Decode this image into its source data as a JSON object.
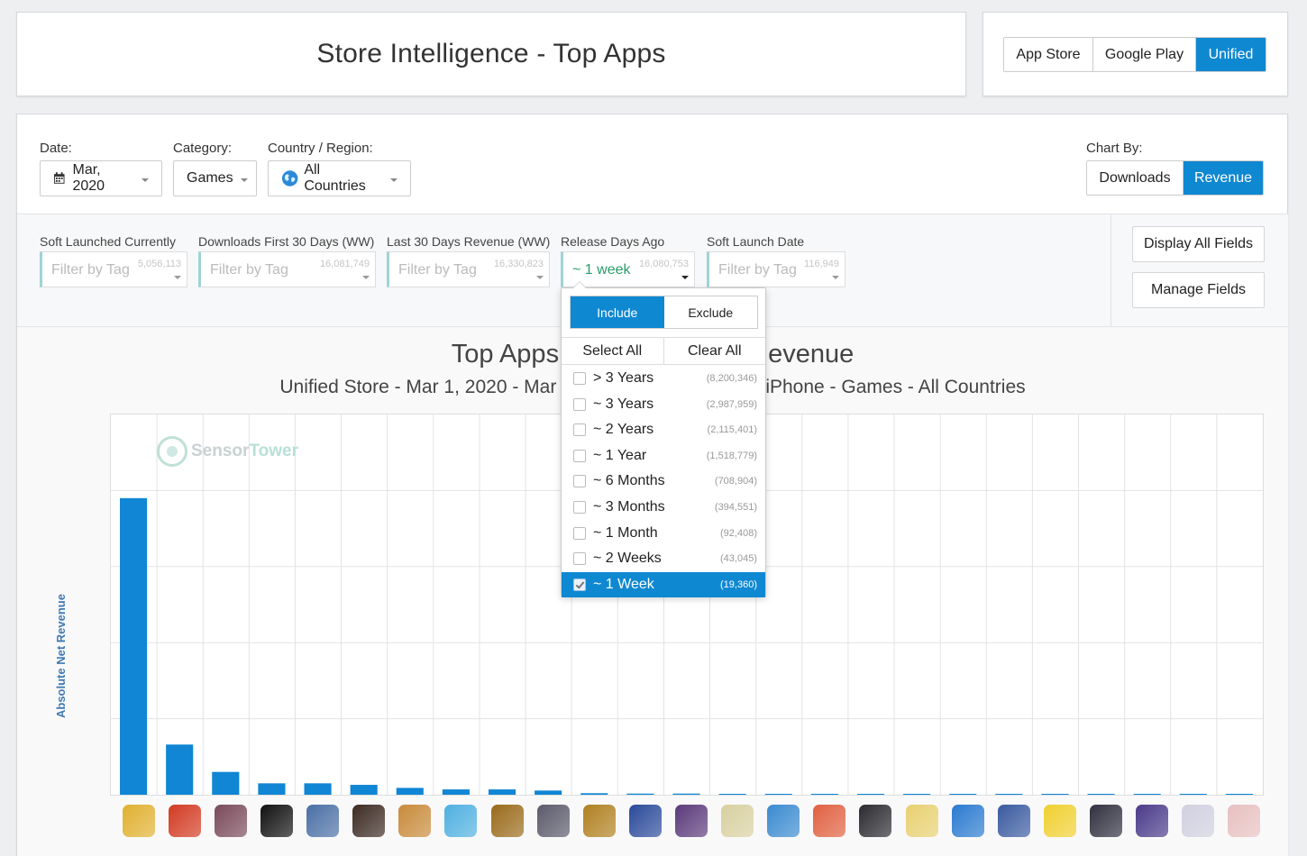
{
  "header": {
    "title": "Store Intelligence - Top Apps"
  },
  "store_toggle": [
    {
      "label": "App Store",
      "active": false
    },
    {
      "label": "Google Play",
      "active": false
    },
    {
      "label": "Unified",
      "active": true
    }
  ],
  "filters": {
    "date_label": "Date:",
    "date_value": "Mar, 2020",
    "category_label": "Category:",
    "category_value": "Games",
    "country_label": "Country / Region:",
    "country_value": "All Countries",
    "chart_by_label": "Chart By:",
    "chart_by": [
      {
        "label": "Downloads",
        "active": false
      },
      {
        "label": "Revenue",
        "active": true
      }
    ]
  },
  "tag_fields": [
    {
      "label": "Soft Launched Currently",
      "placeholder": "Filter by Tag",
      "count": "5,056,113"
    },
    {
      "label": "Downloads First 30 Days (WW)",
      "placeholder": "Filter by Tag",
      "count": "16,081,749"
    },
    {
      "label": "Last 30 Days Revenue (WW)",
      "placeholder": "Filter by Tag",
      "count": "16,330,823"
    },
    {
      "label": "Release Days Ago",
      "value": "~ 1 week",
      "count": "16,080,753"
    },
    {
      "label": "Soft Launch Date",
      "placeholder": "Filter by Tag",
      "count": "116,949"
    }
  ],
  "side_buttons": {
    "display_all": "Display All Fields",
    "manage": "Manage Fields"
  },
  "dropdown": {
    "include": "Include",
    "exclude": "Exclude",
    "select_all": "Select All",
    "clear_all": "Clear All",
    "options": [
      {
        "label": "> 3 Years",
        "count": "(8,200,346)",
        "checked": false
      },
      {
        "label": "~ 3 Years",
        "count": "(2,987,959)",
        "checked": false
      },
      {
        "label": "~ 2 Years",
        "count": "(2,115,401)",
        "checked": false
      },
      {
        "label": "~ 1 Year",
        "count": "(1,518,779)",
        "checked": false
      },
      {
        "label": "~ 6 Months",
        "count": "(708,904)",
        "checked": false
      },
      {
        "label": "~ 3 Months",
        "count": "(394,551)",
        "checked": false
      },
      {
        "label": "~ 1 Month",
        "count": "(92,408)",
        "checked": false
      },
      {
        "label": "~ 2 Weeks",
        "count": "(43,045)",
        "checked": false
      },
      {
        "label": "~ 1 Week",
        "count": "(19,360)",
        "checked": true
      }
    ]
  },
  "chart": {
    "title_left": "Top Apps",
    "title_right": "evenue",
    "subtitle_left": "Unified Store - Mar 1, 2020 - Mar",
    "subtitle_right": "iPhone - Games - All Countries",
    "watermark_a": "Sensor",
    "watermark_b": "Tower"
  },
  "chart_data": {
    "type": "bar",
    "ylabel": "Absolute Net Revenue",
    "ylim": [
      0,
      100
    ],
    "values": [
      78,
      13.2,
      6,
      3,
      3,
      2.6,
      1.8,
      1.4,
      1.4,
      1.1,
      0.4,
      0.3,
      0.3,
      0.2,
      0.2,
      0.15,
      0.12,
      0.1,
      0.1,
      0.08,
      0.07,
      0.06,
      0.05,
      0.05,
      0.04
    ]
  },
  "app_icons": [
    "#e0b030",
    "#d23a22",
    "#7a4a5a",
    "#111111",
    "#4a6fa5",
    "#3b2a22",
    "#c88a3a",
    "#4fb0e0",
    "#9a6a1a",
    "#5a5a6a",
    "#b08020",
    "#2a4a9a",
    "#5a3a7a",
    "#d8d0a0",
    "#3a8ad0",
    "#e06040",
    "#2a2a30",
    "#e8d070",
    "#2a7ad0",
    "#3a5aa0",
    "#f0d030",
    "#303040",
    "#4a3a8a",
    "#d0d0e0",
    "#e8c0c0"
  ],
  "colors": {
    "accent": "#0f88d2",
    "bar": "#1086d4"
  }
}
